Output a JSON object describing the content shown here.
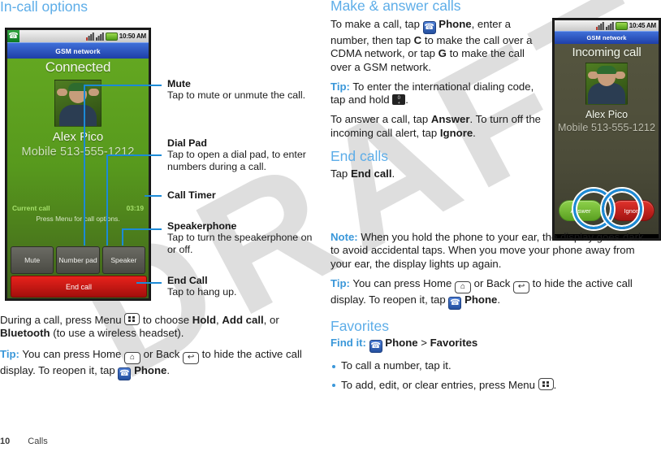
{
  "left": {
    "heading": "In-call options",
    "phone": {
      "status_time": "10:50 AM",
      "network_label": "GSM network",
      "call_state": "Connected",
      "contact_name": "Alex Pico",
      "contact_number": "Mobile 513-555-1212",
      "current_call_label": "Current call",
      "call_timer": "03:19",
      "menu_hint": "Press Menu for call options.",
      "btn_mute": "Mute",
      "btn_numberpad": "Number pad",
      "btn_speaker": "Speaker",
      "btn_endcall": "End call"
    },
    "callouts": [
      {
        "title": "Mute",
        "desc": "Tap to mute or unmute the call."
      },
      {
        "title": "Dial Pad",
        "desc": "Tap to open a dial pad, to enter numbers during a call."
      },
      {
        "title": "Call Timer",
        "desc": ""
      },
      {
        "title": "Speakerphone",
        "desc": "Tap to turn the speakerphone on or off."
      },
      {
        "title": "End Call",
        "desc": "Tap to hang up."
      }
    ],
    "para_during_1": "During a call, press Menu ",
    "para_during_2": " to choose ",
    "para_during_hold": "Hold",
    "para_during_3": ", ",
    "para_during_addcall": "Add call",
    "para_during_4": ", or ",
    "para_during_bluetooth": "Bluetooth",
    "para_during_5": " (to use a wireless headset).",
    "tip_label": "Tip:",
    "tip_1": " You can press Home ",
    "tip_2": " or Back ",
    "tip_3": " to hide the active call display. To reopen it, tap ",
    "tip_phone": "Phone",
    "tip_4": "."
  },
  "right": {
    "heading_make": "Make & answer calls",
    "make_1": "To make a call, tap ",
    "make_phone": "Phone",
    "make_2": ", enter a number, then tap ",
    "make_c": "C",
    "make_3": " to make the call over a CDMA network, or tap ",
    "make_g": "G",
    "make_4": " to make the call over a GSM network.",
    "tip_label": "Tip:",
    "tip_intl_1": " To enter the international dialing code, tap and hold ",
    "tip_intl_2": ".",
    "answer_1": "To answer a call, tap ",
    "answer_bold": "Answer",
    "answer_2": ". To turn off the incoming call alert, tap ",
    "ignore_bold": "Ignore",
    "answer_3": ".",
    "heading_end": "End calls",
    "end_1": "Tap ",
    "end_bold": "End call",
    "end_2": ".",
    "note_label": "Note:",
    "note_text": " When you hold the phone to your ear, the display goes dark to avoid accidental taps. When you move your phone away from your ear, the display lights up again.",
    "tip2_label": "Tip:",
    "tip2_1": " You can press Home ",
    "tip2_2": " or Back ",
    "tip2_3": " to hide the active call display. To reopen it, tap ",
    "tip2_phone": "Phone",
    "tip2_4": ".",
    "heading_fav": "Favorites",
    "findit_label": "Find it:",
    "findit_phone": "Phone",
    "findit_sep": " > ",
    "findit_fav": "Favorites",
    "bullet_1": "To call a number, tap it.",
    "bullet_2a": "To add, edit, or clear entries, press Menu ",
    "bullet_2b": ".",
    "phone": {
      "status_time": "10:45 AM",
      "network_label": "GSM network",
      "call_state": "Incoming call",
      "contact_name": "Alex Pico",
      "contact_number": "Mobile 513-555-1212",
      "btn_answer": "Answer",
      "btn_ignore": "Ignore"
    }
  },
  "footer": {
    "page_number": "10",
    "page_label": "Calls"
  },
  "watermark": {
    "text": "DRAFT"
  },
  "colors": {
    "heading_blue": "#5dade8",
    "accent_blue": "#3a97d9",
    "callout_line": "#1c8ad6",
    "end_call_red": "#e8221c",
    "screen_green": "#57991d",
    "network_blue": "#1e3fa8"
  }
}
